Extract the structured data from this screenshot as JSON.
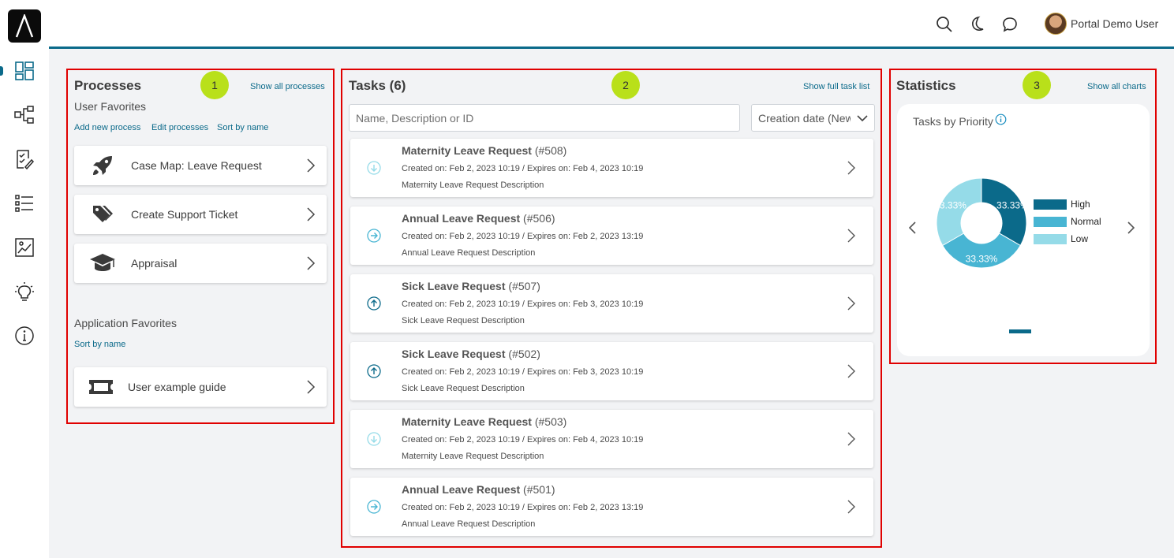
{
  "header": {
    "user_name": "Portal Demo User",
    "icons": [
      "search-icon",
      "dark-mode-moon-icon",
      "chat-bubble-icon"
    ]
  },
  "sidebar": {
    "items": [
      "dashboard-icon",
      "process-icon",
      "task-icon",
      "case-list-icon",
      "statistics-icon",
      "idea-icon",
      "info-icon"
    ],
    "active": "dashboard-icon"
  },
  "badges": [
    "1",
    "2",
    "3"
  ],
  "processes": {
    "title": "Processes",
    "show_all": "Show all processes",
    "user_favorites_label": "User Favorites",
    "actions": {
      "add": "Add new process",
      "edit": "Edit processes",
      "sort": "Sort by name"
    },
    "items": [
      {
        "label": "Case Map: Leave Request",
        "icon": "rocket-icon"
      },
      {
        "label": "Create Support Ticket",
        "icon": "tags-icon"
      },
      {
        "label": "Appraisal",
        "icon": "graduation-cap-icon"
      }
    ],
    "app_favorites_label": "Application Favorites",
    "app_sort": "Sort by name",
    "app_items": [
      {
        "label": "User example guide",
        "icon": "ticket-icon"
      }
    ]
  },
  "tasks": {
    "title": "Tasks (6)",
    "show_full": "Show full task list",
    "search_placeholder": "Name, Description or ID",
    "sort_value": "Creation date (Newest)",
    "items": [
      {
        "name": "Maternity Leave Request",
        "id": "(#508)",
        "dates": "Created on: Feb 2, 2023 10:19 / Expires on: Feb 4, 2023 10:19",
        "description": "Maternity Leave Request Description",
        "priority": "low"
      },
      {
        "name": "Annual Leave Request",
        "id": "(#506)",
        "dates": "Created on: Feb 2, 2023 10:19 / Expires on: Feb 2, 2023 13:19",
        "description": "Annual Leave Request Description",
        "priority": "normal"
      },
      {
        "name": "Sick Leave Request",
        "id": "(#507)",
        "dates": "Created on: Feb 2, 2023 10:19 / Expires on: Feb 3, 2023 10:19",
        "description": "Sick Leave Request Description",
        "priority": "high"
      },
      {
        "name": "Sick Leave Request",
        "id": "(#502)",
        "dates": "Created on: Feb 2, 2023 10:19 / Expires on: Feb 3, 2023 10:19",
        "description": "Sick Leave Request Description",
        "priority": "high"
      },
      {
        "name": "Maternity Leave Request",
        "id": "(#503)",
        "dates": "Created on: Feb 2, 2023 10:19 / Expires on: Feb 4, 2023 10:19",
        "description": "Maternity Leave Request Description",
        "priority": "low"
      },
      {
        "name": "Annual Leave Request",
        "id": "(#501)",
        "dates": "Created on: Feb 2, 2023 10:19 / Expires on: Feb 2, 2023 13:19",
        "description": "Annual Leave Request Description",
        "priority": "normal"
      }
    ]
  },
  "statistics": {
    "title": "Statistics",
    "show_all": "Show all charts"
  },
  "chart_data": {
    "type": "pie",
    "variant": "donut",
    "title": "Tasks by Priority",
    "categories": [
      "High",
      "Normal",
      "Low"
    ],
    "values": [
      33.33,
      33.33,
      33.33
    ],
    "labels": [
      "33.33%",
      "33.33%",
      "33.33%"
    ],
    "colors": [
      "#0b6a8a",
      "#48b5d3",
      "#95dbe8"
    ],
    "legend": "right"
  },
  "colors": {
    "accent": "#0b6a8a",
    "badge": "#b9e01a",
    "annotation_box": "#e00000",
    "priority_high": "#0b6a8a",
    "priority_normal": "#48b5d3",
    "priority_low": "#95dbe8"
  }
}
